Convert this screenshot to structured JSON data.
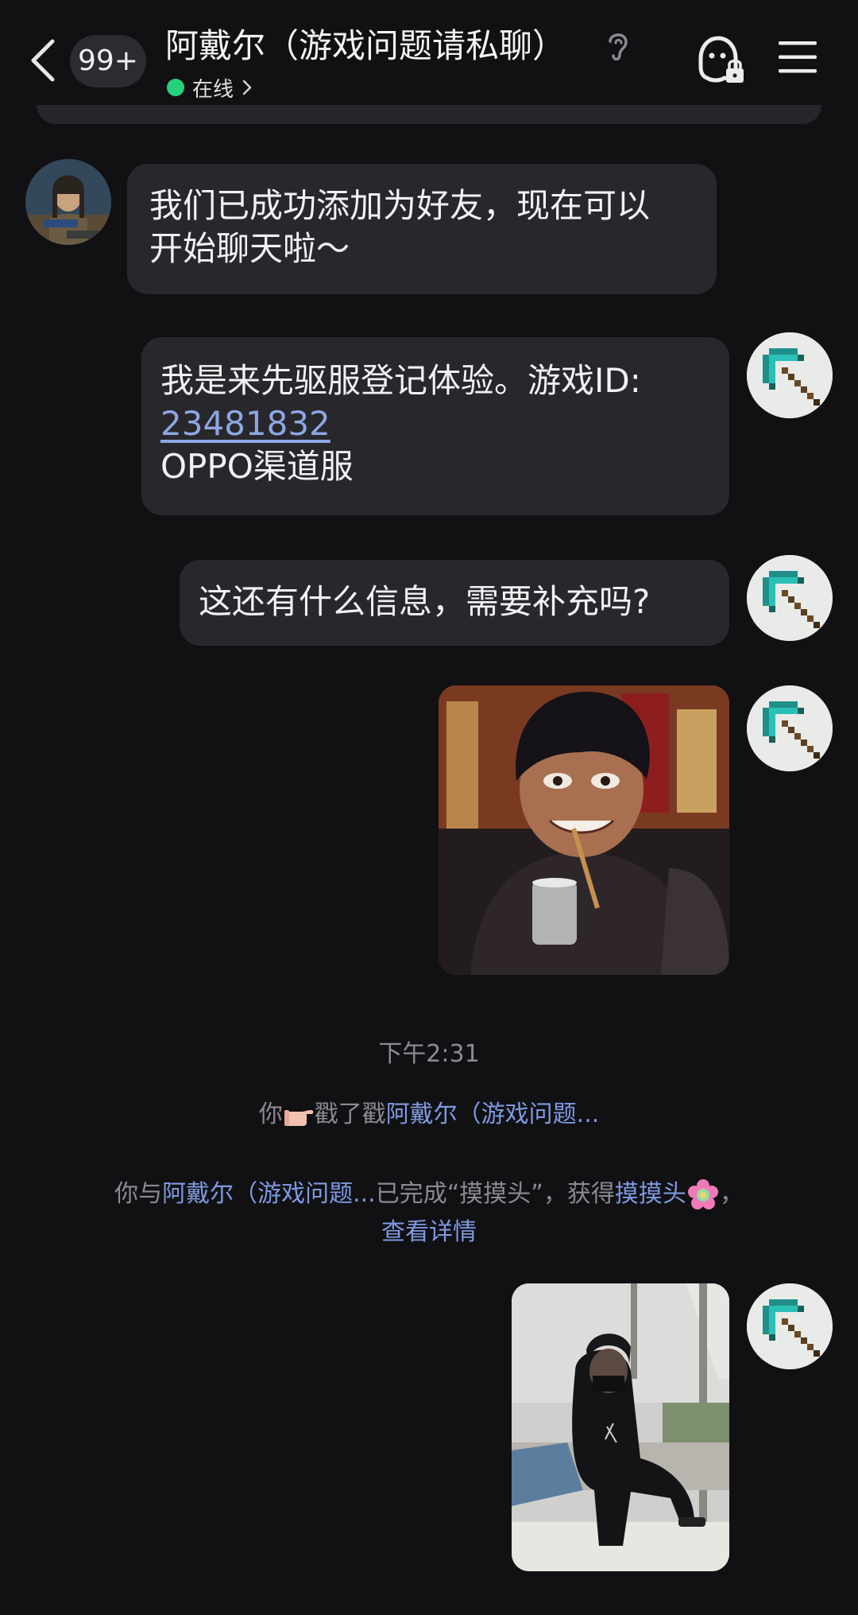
{
  "header": {
    "unread_count": "99+",
    "contact_name": "阿戴尔（游戏问题请私聊）",
    "status": "在线",
    "status_color": "#27d07a"
  },
  "messages": [
    {
      "side": "incoming",
      "lines": [
        "我们已成功添加为好友，现在可以",
        "开始聊天啦～"
      ]
    },
    {
      "side": "outgoing",
      "line1": "我是来先驱服登记体验。游戏ID:",
      "game_id": "23481832",
      "line3": "OPPO渠道服"
    },
    {
      "side": "outgoing",
      "text": "这还有什么信息，需要补充吗?"
    },
    {
      "side": "outgoing",
      "type": "image",
      "icon": "photo-sticker"
    },
    {
      "side": "outgoing",
      "type": "image",
      "icon": "photo-person"
    }
  ],
  "system": {
    "time": "下午2:31",
    "poke_prefix": "你",
    "poke_action": "戳了戳",
    "poke_target": "阿戴尔（游戏问题...",
    "achv_prefix": "你与",
    "achv_target": "阿戴尔（游戏问题...",
    "achv_middle": "已完成“摸摸头”，获得",
    "achv_badge": "摸摸头",
    "achv_suffix": "，",
    "view_details": "查看详情"
  },
  "colors": {
    "background": "#111114",
    "bubble": "#28282c",
    "link": "#7d9ae0"
  }
}
